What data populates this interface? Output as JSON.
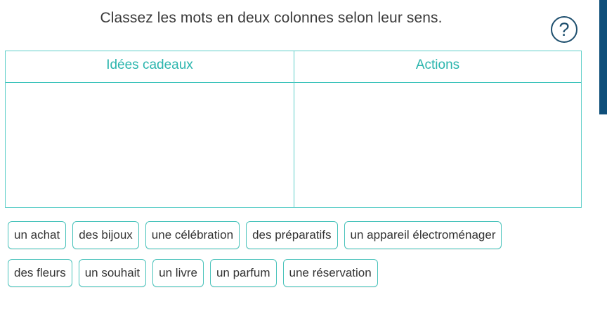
{
  "instruction": "Classez les mots en deux colonnes selon leur sens.",
  "help": {
    "glyph": "?",
    "icon": "question-circle-icon"
  },
  "columns": [
    {
      "label": "Idées cadeaux"
    },
    {
      "label": "Actions"
    }
  ],
  "words": {
    "row1": [
      "un achat",
      "des bijoux",
      "une célébration",
      "des préparatifs",
      "un appareil électroménager"
    ],
    "row2": [
      "des fleurs",
      "un souhait",
      "un livre",
      "un parfum",
      "une réservation"
    ]
  },
  "colors": {
    "accent": "#3cc3bb",
    "header_text": "#2bb5ad",
    "help": "#1e4f6e",
    "edge_bar": "#0f4f7a"
  }
}
